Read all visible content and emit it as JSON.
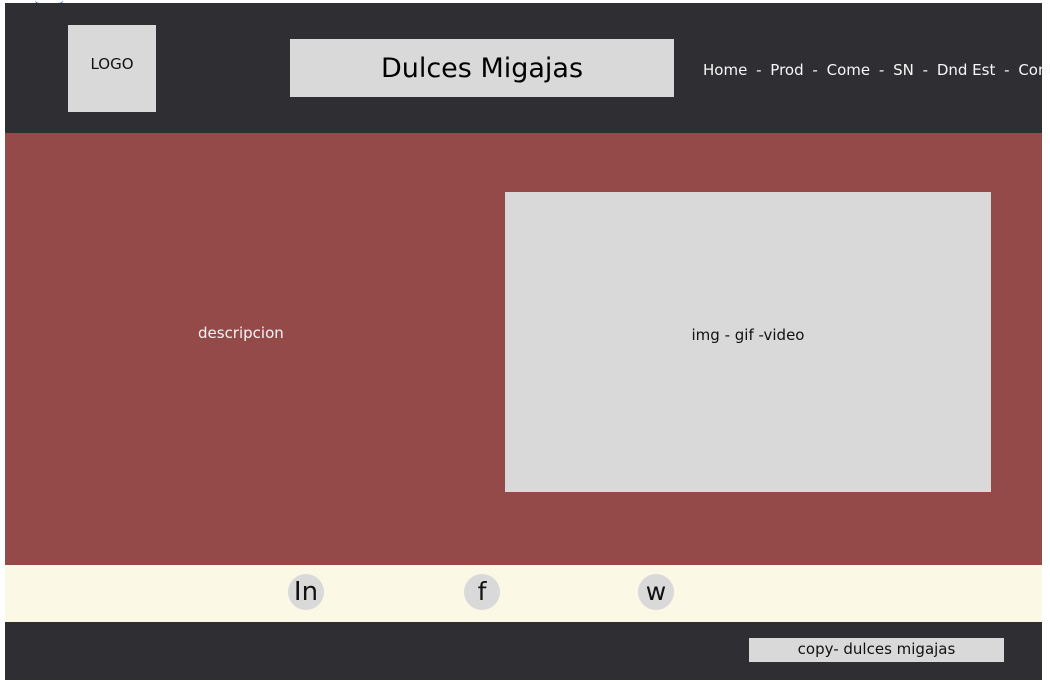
{
  "header": {
    "logo": "LOGO",
    "title": "Dulces Migajas",
    "nav": [
      "Home",
      "Prod",
      "Come",
      "SN",
      "Dnd Est",
      "Cont"
    ],
    "nav_separator": "-"
  },
  "hero": {
    "description": "descripcion",
    "media": "img - gif -video"
  },
  "social": {
    "linkedin": "In",
    "facebook": "f",
    "whatsapp": "w"
  },
  "footer": {
    "copy": "copy- dulces migajas"
  },
  "colors": {
    "header_background": "#2f2e33",
    "hero_background": "#954a4a",
    "social_background": "#fbf8e6",
    "placeholder_background": "#d9d9d9",
    "top_mark": "#3555d4"
  }
}
